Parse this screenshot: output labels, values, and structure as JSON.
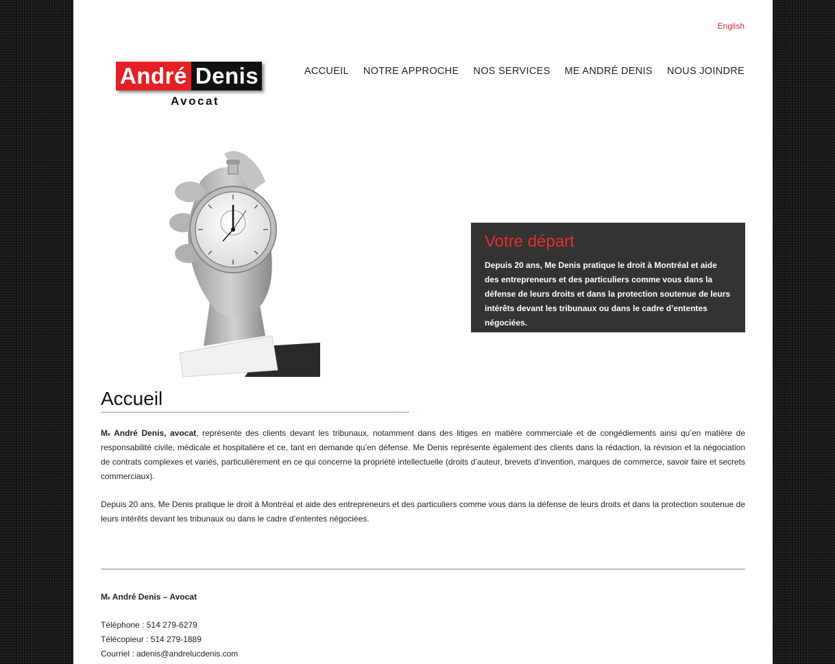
{
  "header": {
    "language_link": "English",
    "logo": {
      "name_first": "André",
      "name_last": "Denis",
      "subtitle": "Avocat"
    },
    "nav": [
      {
        "label": "ACCUEIL"
      },
      {
        "label": "NOTRE APPROCHE"
      },
      {
        "label": "NOS SERVICES"
      },
      {
        "label": "ME ANDRÉ DENIS"
      },
      {
        "label": "NOUS JOINDRE"
      }
    ]
  },
  "hero": {
    "image": "hand-holding-stopwatch",
    "callout_title": "Votre départ",
    "callout_text": "Depuis 20 ans, Me Denis pratique le droit à Montréal et aide des entrepreneurs et des particuliers comme vous dans la défense de leurs droits et dans la protection soutenue de leurs intérêts devant les tribunaux ou dans le cadre d’ententes négociées."
  },
  "main": {
    "title": "Accueil",
    "para1_prefix": "M",
    "para1_sup": "e",
    "para1_bold": " André Denis, avocat",
    "para1_text": ", représente des clients devant les tribunaux, notamment dans des litiges en matière commerciale et de congédiements ainsi qu’en matière de responsabilité civile, médicale et hospitalière et ce, tant en demande qu’en défense. Me Denis représente également des clients dans la rédaction, la révision et la négociation de contrats complexes et variés, particulièrement en ce qui concerne la propriété intellectuelle (droits d’auteur, brevets d’invention, marques de commerce, savoir faire et secrets commerciaux).",
    "para2": "Depuis 20 ans, Me Denis pratique le droit à Montréal et aide des entrepreneurs et des particuliers comme vous dans la défense de leurs droits et dans la protection soutenue de leurs intérêts devant les tribunaux ou dans le cadre d’ententes négociées."
  },
  "footer": {
    "name_prefix": "M",
    "name_sup": "e",
    "name_rest": " André Denis – Avocat",
    "phone": "Téléphone : 514 279-6279",
    "fax": "Télécopieur : 514 279-1889",
    "email": "Courriel : adenis@andrelucdenis.com"
  },
  "colors": {
    "accent": "#e41f26",
    "callout_bg": "#333333",
    "page_bg": "#161616"
  }
}
